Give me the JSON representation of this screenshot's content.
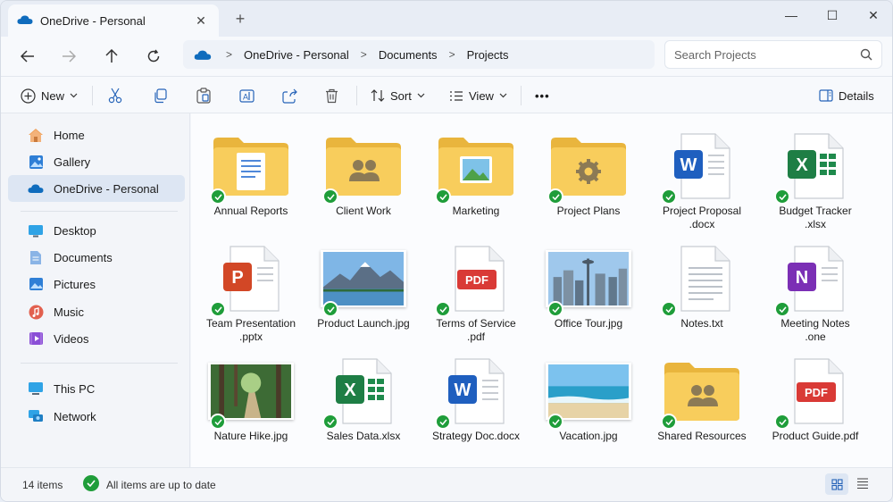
{
  "tab": {
    "title": "OneDrive - Personal",
    "close": "✕",
    "new": "+"
  },
  "window_controls": {
    "minimize": "—",
    "maximize": "☐",
    "close": "✕"
  },
  "address": {
    "crumbs": [
      "OneDrive - Personal",
      "Documents",
      "Projects"
    ],
    "separator": ">"
  },
  "search": {
    "placeholder": "Search Projects"
  },
  "toolbar": {
    "new_label": "New",
    "sort_label": "Sort",
    "view_label": "View",
    "more_label": "•••",
    "details_label": "Details"
  },
  "sidebar": {
    "items": [
      {
        "label": "Home",
        "icon": "home-icon"
      },
      {
        "label": "Gallery",
        "icon": "gallery-icon"
      },
      {
        "label": "OneDrive - Personal",
        "icon": "onedrive-icon"
      },
      {
        "label": "Desktop",
        "icon": "desktop-icon"
      },
      {
        "label": "Documents",
        "icon": "documents-icon"
      },
      {
        "label": "Pictures",
        "icon": "pictures-icon"
      },
      {
        "label": "Music",
        "icon": "music-icon"
      },
      {
        "label": "Videos",
        "icon": "videos-icon"
      },
      {
        "label": "This PC",
        "icon": "pc-icon"
      },
      {
        "label": "Network",
        "icon": "network-icon"
      }
    ]
  },
  "files": [
    {
      "name": "Annual Reports",
      "name2": "",
      "type": "folder-doc"
    },
    {
      "name": "Client Work",
      "name2": "",
      "type": "folder-people"
    },
    {
      "name": "Marketing",
      "name2": "",
      "type": "folder-image"
    },
    {
      "name": "Project Plans",
      "name2": "",
      "type": "folder-gear"
    },
    {
      "name": "Project Proposal",
      "name2": ".docx",
      "type": "word"
    },
    {
      "name": "Budget Tracker",
      "name2": ".xlsx",
      "type": "excel"
    },
    {
      "name": "Team Presentation",
      "name2": ".pptx",
      "type": "ppt"
    },
    {
      "name": "Product Launch.jpg",
      "name2": "",
      "type": "img-mountain"
    },
    {
      "name": "Terms of Service",
      "name2": ".pdf",
      "type": "pdf"
    },
    {
      "name": "Office Tour.jpg",
      "name2": "",
      "type": "img-city"
    },
    {
      "name": "Notes.txt",
      "name2": "",
      "type": "txt"
    },
    {
      "name": "Meeting Notes",
      "name2": ".one",
      "type": "onenote"
    },
    {
      "name": "Nature Hike.jpg",
      "name2": "",
      "type": "img-forest"
    },
    {
      "name": "Sales Data.xlsx",
      "name2": "",
      "type": "excel"
    },
    {
      "name": "Strategy Doc.docx",
      "name2": "",
      "type": "word"
    },
    {
      "name": "Vacation.jpg",
      "name2": "",
      "type": "img-beach"
    },
    {
      "name": "Shared Resources",
      "name2": "",
      "type": "folder-people"
    },
    {
      "name": "Product Guide.pdf",
      "name2": "",
      "type": "pdf"
    }
  ],
  "status": {
    "count": "14 items",
    "sync": "All items are up to date"
  },
  "colors": {
    "accent": "#0f6cbd",
    "sync_green": "#1f9d3a",
    "folder": "#f8c84a"
  }
}
